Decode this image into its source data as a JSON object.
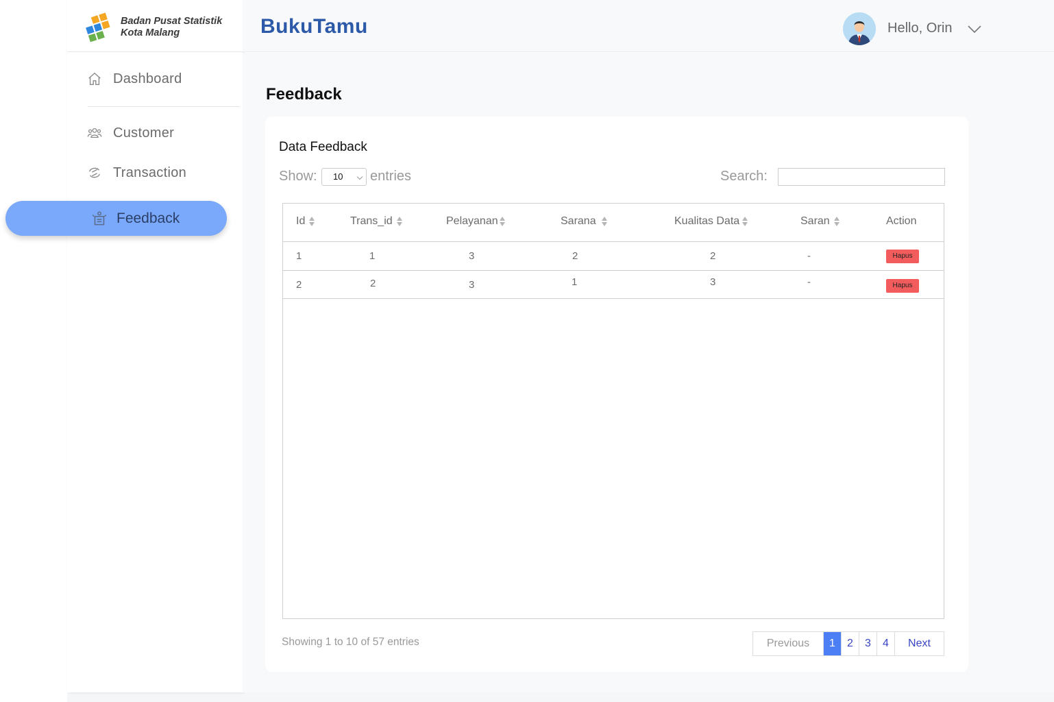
{
  "org": {
    "line1": "Badan Pusat Statistik",
    "line2": "Kota Malang"
  },
  "app": {
    "brand": "BukuTamu"
  },
  "user": {
    "greeting": "Hello, Orin"
  },
  "sidebar": {
    "items": [
      {
        "label": "Dashboard",
        "icon": "home-icon"
      },
      {
        "label": "Customer",
        "icon": "users-icon"
      },
      {
        "label": "Transaction",
        "icon": "exchange-icon"
      },
      {
        "label": "Feedback",
        "icon": "feedback-icon",
        "active": true
      }
    ]
  },
  "page": {
    "title": "Feedback"
  },
  "card": {
    "title": "Data Feedback"
  },
  "controls": {
    "show_label": "Show:",
    "page_size": "10",
    "entries_label": "entries",
    "search_label": "Search:",
    "search_value": ""
  },
  "table": {
    "headers": [
      "Id",
      "Trans_id",
      "Pelayanan",
      "Sarana",
      "Kualitas Data",
      "Saran",
      "Action"
    ],
    "rows": [
      {
        "id": "1",
        "trans_id": "1",
        "pelayanan": "3",
        "sarana": "2",
        "kualitas_data": "2",
        "saran": "-",
        "action": "Hapus"
      },
      {
        "id": "2",
        "trans_id": "2",
        "pelayanan": "3",
        "sarana": "1",
        "kualitas_data": "3",
        "saran": "-",
        "action": "Hapus"
      }
    ]
  },
  "footer": {
    "info": "Showing 1 to 10 of 57 entries",
    "previous": "Previous",
    "pages": [
      "1",
      "2",
      "3",
      "4"
    ],
    "current_page": "1",
    "next": "Next"
  },
  "colors": {
    "accent": "#4c7ef6",
    "sidebar_active": "#7aa9fb",
    "brand": "#2c5aa8",
    "danger": "#f25c5c"
  }
}
